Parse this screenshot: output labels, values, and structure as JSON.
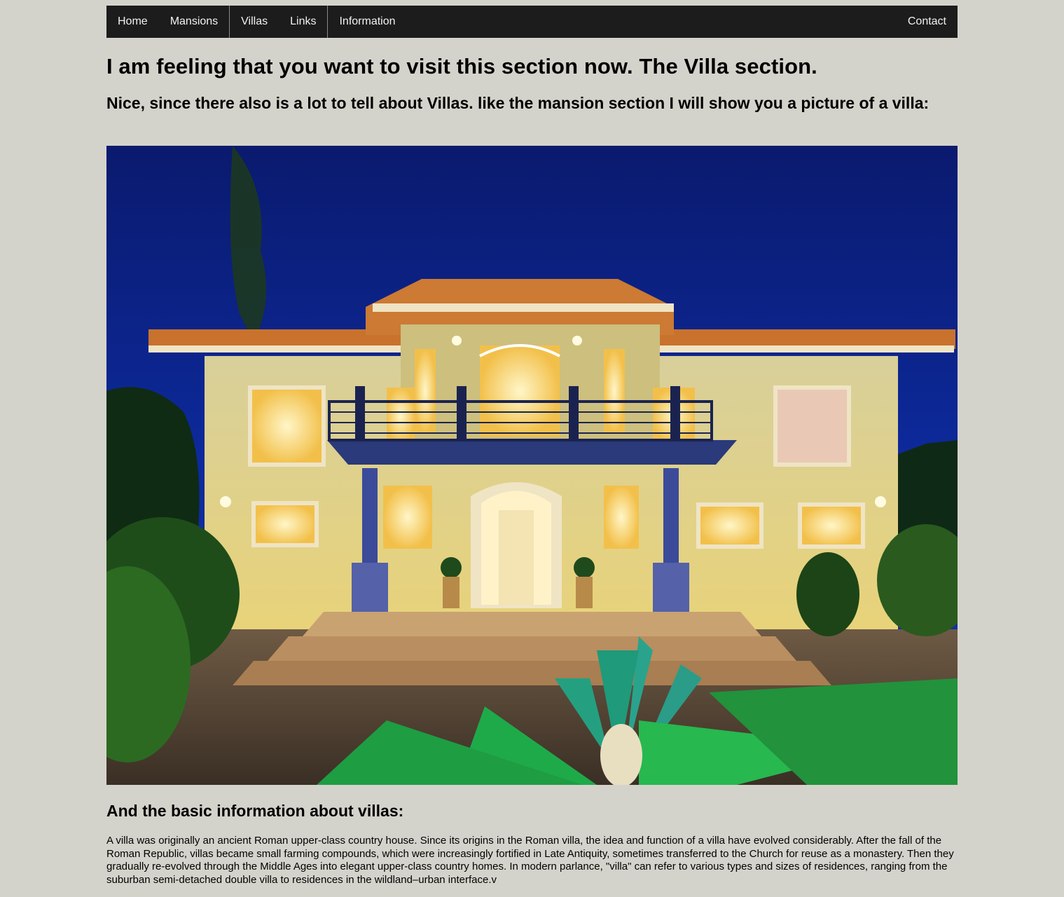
{
  "nav": {
    "home": "Home",
    "mansions": "Mansions",
    "villas": "Villas",
    "links": "Links",
    "information": "Information",
    "contact": "Contact"
  },
  "heading": "I am feeling that you want to visit this section now. The Villa section.",
  "intro": "Nice, since there also is a lot to tell about Villas. like the mansion section I will show you a picture of a villa:",
  "info_heading": "And the basic information about villas:",
  "info_text": "A villa was originally an ancient Roman upper-class country house. Since its origins in the Roman villa, the idea and function of a villa have evolved considerably. After the fall of the Roman Republic, villas became small farming compounds, which were increasingly fortified in Late Antiquity, sometimes transferred to the Church for reuse as a monastery. Then they gradually re-evolved through the Middle Ages into elegant upper-class country homes. In modern parlance, \"villa\" can refer to various types and sizes of residences, ranging from the suburban semi-detached double villa to residences in the wildland–urban interface.v",
  "colors": {
    "page_bg": "#d4d3cb",
    "nav_bg": "#1c1c1c",
    "nav_text": "#f2f2f2"
  }
}
